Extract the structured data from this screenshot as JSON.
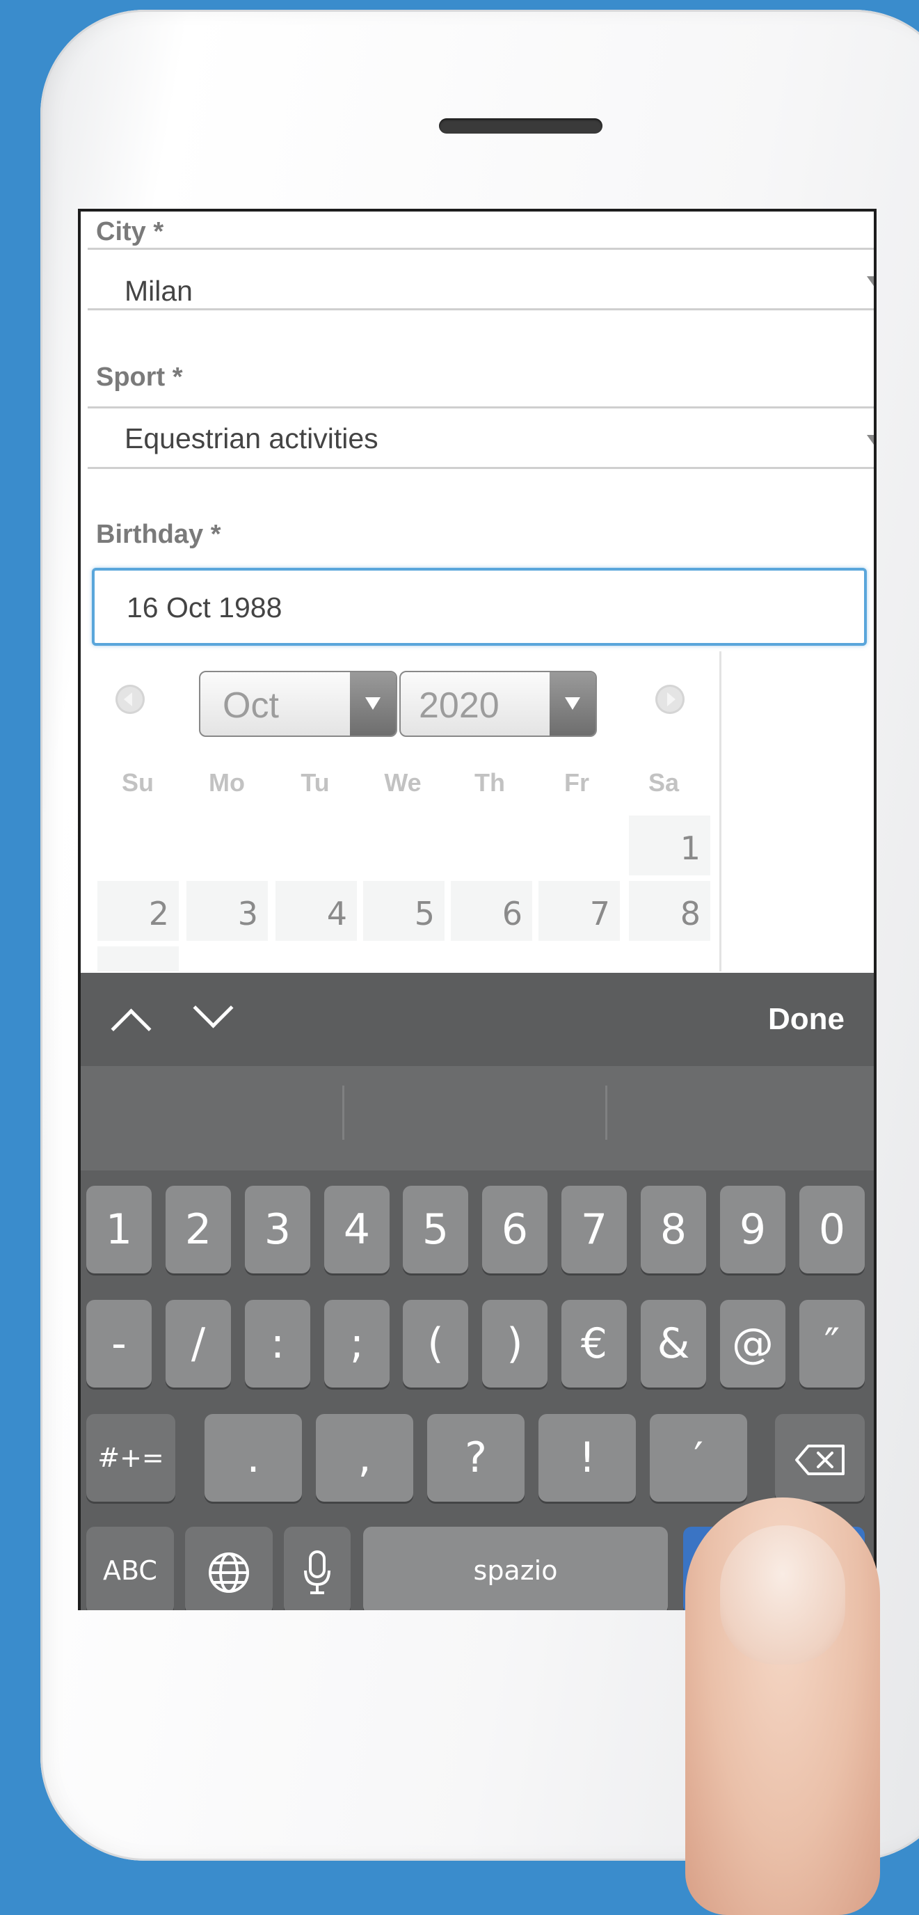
{
  "form": {
    "city_label": "City *",
    "city_value": "Milan",
    "sport_label": "Sport *",
    "sport_value": "Equestrian activities",
    "birthday_label": "Birthday *",
    "birthday_value": "16 Oct 1988"
  },
  "datepicker": {
    "month": "Oct",
    "year": "2020",
    "weekdays": [
      "Su",
      "Mo",
      "Tu",
      "We",
      "Th",
      "Fr",
      "Sa"
    ],
    "days": [
      "1",
      "2",
      "3",
      "4",
      "5",
      "6",
      "7",
      "8"
    ]
  },
  "keyboard": {
    "done_label": "Done",
    "row1": [
      "1",
      "2",
      "3",
      "4",
      "5",
      "6",
      "7",
      "8",
      "9",
      "0"
    ],
    "row2": [
      "-",
      "/",
      ":",
      ";",
      "(",
      ")",
      "€",
      "&",
      "@",
      "″"
    ],
    "row3": [
      "#+=",
      ".",
      ",",
      "?",
      "!",
      "′"
    ],
    "abc_label": "ABC",
    "space_label": "spazio",
    "icons": [
      "chevron-up-icon",
      "chevron-down-icon",
      "backspace-icon",
      "globe-icon",
      "microphone-icon"
    ]
  },
  "colors": {
    "background": "#3a8ccc",
    "focus_border": "#5aa6db",
    "return_key": "#3a74c4"
  }
}
